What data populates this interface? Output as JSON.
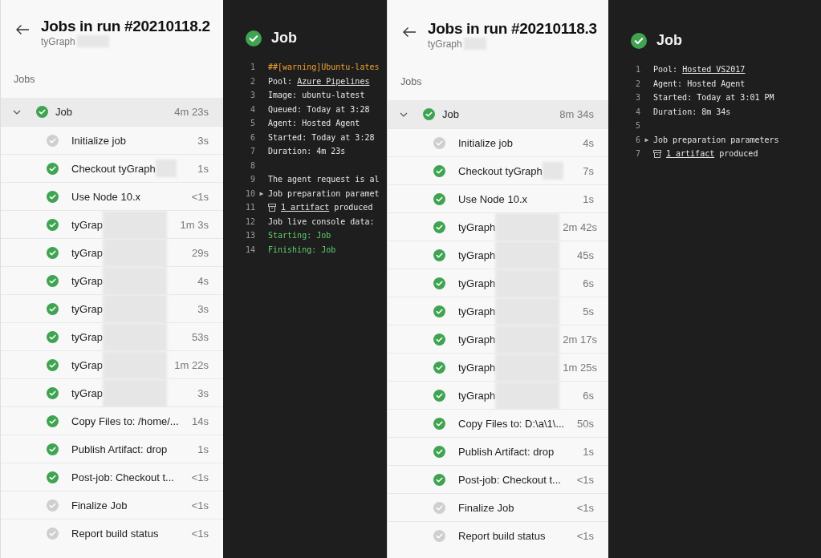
{
  "runs": [
    {
      "title": "Jobs in run #20210118.2",
      "subtitle": "tyGraph",
      "subtitle_redacted": true,
      "section": "Jobs",
      "job": {
        "name": "Job",
        "duration": "4m 23s",
        "expanded": true,
        "skipped": false
      },
      "steps": [
        {
          "name": "Initialize job",
          "duration": "3s",
          "skipped": true,
          "redacted": false
        },
        {
          "name": "Checkout tyGraph",
          "duration": "1s",
          "skipped": false,
          "redacted": true
        },
        {
          "name": "Use Node 10.x",
          "duration": "<1s",
          "skipped": false,
          "redacted": false
        },
        {
          "name": "tyGrap",
          "duration": "1m 3s",
          "skipped": false,
          "redacted": true
        },
        {
          "name": "tyGrap",
          "duration": "29s",
          "skipped": false,
          "redacted": true
        },
        {
          "name": "tyGrap",
          "duration": "4s",
          "skipped": false,
          "redacted": true
        },
        {
          "name": "tyGrap",
          "duration": "3s",
          "skipped": false,
          "redacted": true
        },
        {
          "name": "tyGrap",
          "duration": "53s",
          "skipped": false,
          "redacted": true
        },
        {
          "name": "tyGrap",
          "duration": "1m 22s",
          "skipped": false,
          "redacted": true
        },
        {
          "name": "tyGrap",
          "duration": "3s",
          "skipped": false,
          "redacted": true
        },
        {
          "name": "Copy Files to: /home/...",
          "duration": "14s",
          "skipped": false,
          "redacted": false
        },
        {
          "name": "Publish Artifact: drop",
          "duration": "1s",
          "skipped": false,
          "redacted": false
        },
        {
          "name": "Post-job: Checkout t...",
          "duration": "<1s",
          "skipped": false,
          "redacted": false
        },
        {
          "name": "Finalize Job",
          "duration": "<1s",
          "skipped": true,
          "redacted": false
        },
        {
          "name": "Report build status",
          "duration": "<1s",
          "skipped": true,
          "redacted": false
        }
      ],
      "log": {
        "title": "Job",
        "skipped": false,
        "lines": [
          {
            "number": "1",
            "segments": [
              {
                "kind": "warning",
                "text": "##[warning]Ubuntu-lates"
              }
            ]
          },
          {
            "number": "2",
            "segments": [
              {
                "kind": "plain",
                "text": "Pool: "
              },
              {
                "kind": "link",
                "text": "Azure Pipelines"
              }
            ]
          },
          {
            "number": "3",
            "segments": [
              {
                "kind": "plain",
                "text": "Image: ubuntu-latest"
              }
            ]
          },
          {
            "number": "4",
            "segments": [
              {
                "kind": "plain",
                "text": "Queued: Today at 3:28"
              }
            ]
          },
          {
            "number": "5",
            "segments": [
              {
                "kind": "plain",
                "text": "Agent: Hosted Agent"
              }
            ]
          },
          {
            "number": "6",
            "segments": [
              {
                "kind": "plain",
                "text": "Started: Today at 3:28"
              }
            ]
          },
          {
            "number": "7",
            "segments": [
              {
                "kind": "plain",
                "text": "Duration: 4m 23s"
              }
            ]
          },
          {
            "number": "8"
          },
          {
            "number": "9",
            "segments": [
              {
                "kind": "plain",
                "text": "The agent request is al"
              }
            ]
          },
          {
            "number": "10",
            "toggle": "▶",
            "segments": [
              {
                "kind": "plain",
                "text": "Job preparation paramet"
              }
            ]
          },
          {
            "number": "11",
            "artifact": true,
            "segments": [
              {
                "kind": "link",
                "text": "1 artifact"
              },
              {
                "kind": "plain",
                "text": " produced"
              }
            ]
          },
          {
            "number": "12",
            "segments": [
              {
                "kind": "plain",
                "text": "Job live console data:"
              }
            ]
          },
          {
            "number": "13",
            "segments": [
              {
                "kind": "success",
                "text": "Starting: Job"
              }
            ]
          },
          {
            "number": "14",
            "segments": [
              {
                "kind": "success",
                "text": "Finishing: Job"
              }
            ]
          }
        ]
      }
    },
    {
      "title": "Jobs in run #20210118.3",
      "subtitle": "tyGraph",
      "subtitle_redacted": true,
      "section": "Jobs",
      "job": {
        "name": "Job",
        "duration": "8m 34s",
        "expanded": true,
        "skipped": false
      },
      "steps": [
        {
          "name": "Initialize job",
          "duration": "4s",
          "skipped": true,
          "redacted": false
        },
        {
          "name": "Checkout tyGraph",
          "duration": "7s",
          "skipped": false,
          "redacted": true
        },
        {
          "name": "Use Node 10.x",
          "duration": "1s",
          "skipped": false,
          "redacted": false
        },
        {
          "name": "tyGraph",
          "duration": "2m 42s",
          "skipped": false,
          "redacted": true
        },
        {
          "name": "tyGraph",
          "duration": "45s",
          "skipped": false,
          "redacted": true
        },
        {
          "name": "tyGraph",
          "duration": "6s",
          "skipped": false,
          "redacted": true
        },
        {
          "name": "tyGraph",
          "duration": "5s",
          "skipped": false,
          "redacted": true
        },
        {
          "name": "tyGraph",
          "duration": "2m 17s",
          "skipped": false,
          "redacted": true
        },
        {
          "name": "tyGraph",
          "duration": "1m 25s",
          "skipped": false,
          "redacted": true
        },
        {
          "name": "tyGraph",
          "duration": "6s",
          "skipped": false,
          "redacted": true
        },
        {
          "name": "Copy Files to: D:\\a\\1\\...",
          "duration": "50s",
          "skipped": false,
          "redacted": false
        },
        {
          "name": "Publish Artifact: drop",
          "duration": "1s",
          "skipped": false,
          "redacted": false
        },
        {
          "name": "Post-job: Checkout t...",
          "duration": "<1s",
          "skipped": false,
          "redacted": false
        },
        {
          "name": "Finalize Job",
          "duration": "<1s",
          "skipped": true,
          "redacted": false
        },
        {
          "name": "Report build status",
          "duration": "<1s",
          "skipped": true,
          "redacted": false
        }
      ],
      "log": {
        "title": "Job",
        "skipped": false,
        "lines": [
          {
            "number": "1",
            "segments": [
              {
                "kind": "plain",
                "text": "Pool: "
              },
              {
                "kind": "link",
                "text": "Hosted VS2017"
              }
            ]
          },
          {
            "number": "2",
            "segments": [
              {
                "kind": "plain",
                "text": "Agent: Hosted Agent"
              }
            ]
          },
          {
            "number": "3",
            "segments": [
              {
                "kind": "plain",
                "text": "Started: Today at 3:01 PM"
              }
            ]
          },
          {
            "number": "4",
            "segments": [
              {
                "kind": "plain",
                "text": "Duration: 8m 34s"
              }
            ]
          },
          {
            "number": "5"
          },
          {
            "number": "6",
            "toggle": "▶",
            "segments": [
              {
                "kind": "plain",
                "text": "Job preparation parameters"
              }
            ]
          },
          {
            "number": "7",
            "artifact": true,
            "segments": [
              {
                "kind": "link",
                "text": "1 artifact"
              },
              {
                "kind": "plain",
                "text": " produced"
              }
            ]
          }
        ]
      }
    }
  ]
}
